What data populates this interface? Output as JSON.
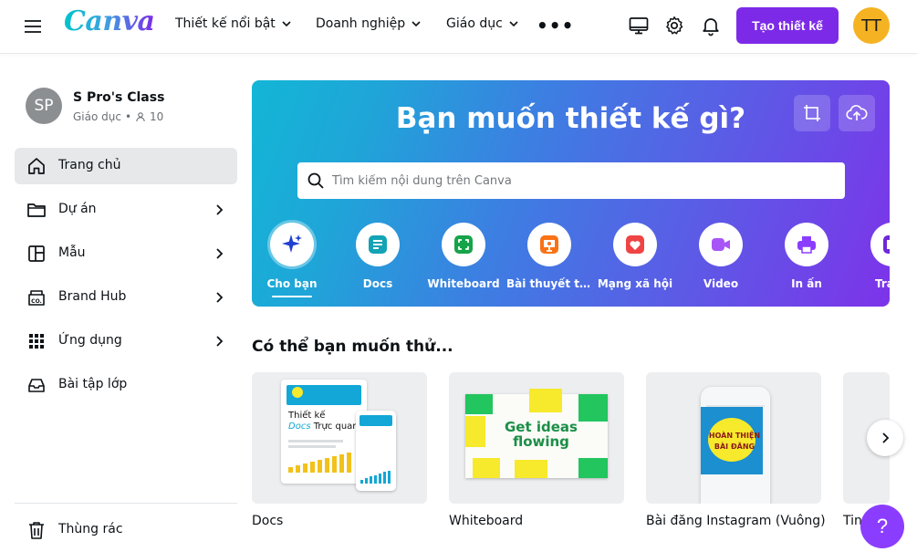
{
  "header": {
    "logo": "Canva",
    "nav": [
      {
        "label": "Thiết kế nổi bật"
      },
      {
        "label": "Doanh nghiệp"
      },
      {
        "label": "Giáo dục"
      }
    ],
    "more_label": "•••",
    "create_button": "Tạo thiết kế",
    "user_initials": "TT",
    "icons": [
      "desktop-icon",
      "gear-icon",
      "bell-icon"
    ]
  },
  "sidebar": {
    "team": {
      "initials": "SP",
      "name": "S Pro's Class",
      "type": "Giáo dục",
      "members": "10"
    },
    "items": [
      {
        "label": "Trang chủ",
        "icon": "home-icon",
        "active": true
      },
      {
        "label": "Dự án",
        "icon": "folder-icon",
        "chevron": true
      },
      {
        "label": "Mẫu",
        "icon": "template-icon",
        "chevron": true
      },
      {
        "label": "Brand Hub",
        "icon": "brand-hub-icon",
        "chevron": true
      },
      {
        "label": "Ứng dụng",
        "icon": "apps-grid-icon",
        "chevron": true
      },
      {
        "label": "Bài tập lớp",
        "icon": "inbox-icon"
      }
    ],
    "trash": {
      "label": "Thùng rác",
      "icon": "trash-icon"
    }
  },
  "hero": {
    "title": "Bạn muốn thiết kế gì?",
    "search_placeholder": "Tìm kiếm nội dung trên Canva",
    "categories": [
      {
        "label": "Cho bạn",
        "icon": "sparkle-icon",
        "color": "#1f3fd1",
        "selected": true
      },
      {
        "label": "Docs",
        "icon": "docs-icon",
        "color": "#13a3b5"
      },
      {
        "label": "Whiteboard",
        "icon": "whiteboard-icon",
        "color": "#16a34a"
      },
      {
        "label": "Bài thuyết trì...",
        "icon": "presentation-icon",
        "color": "#f97316"
      },
      {
        "label": "Mạng xã hội",
        "icon": "social-heart-icon",
        "color": "#ef4444"
      },
      {
        "label": "Video",
        "icon": "video-icon",
        "color": "#a855f7"
      },
      {
        "label": "In ấn",
        "icon": "print-icon",
        "color": "#8b3dff"
      },
      {
        "label": "Trang",
        "icon": "website-icon",
        "color": "#6d28d9"
      }
    ]
  },
  "suggestions": {
    "title": "Có thể bạn muốn thử...",
    "cards": [
      {
        "label": "Docs",
        "thumb_text_1": "Thiết kế",
        "thumb_text_2": "Docs",
        "thumb_text_3": "Trực quan"
      },
      {
        "label": "Whiteboard",
        "thumb_text_1": "Get ideas",
        "thumb_text_2": "flowing"
      },
      {
        "label": "Bài đăng Instagram (Vuông)",
        "thumb_text_1": "HOÀN THIỆN",
        "thumb_text_2": "BÀI ĐĂNG"
      },
      {
        "label": "Tin"
      }
    ]
  },
  "help_label": "?"
}
